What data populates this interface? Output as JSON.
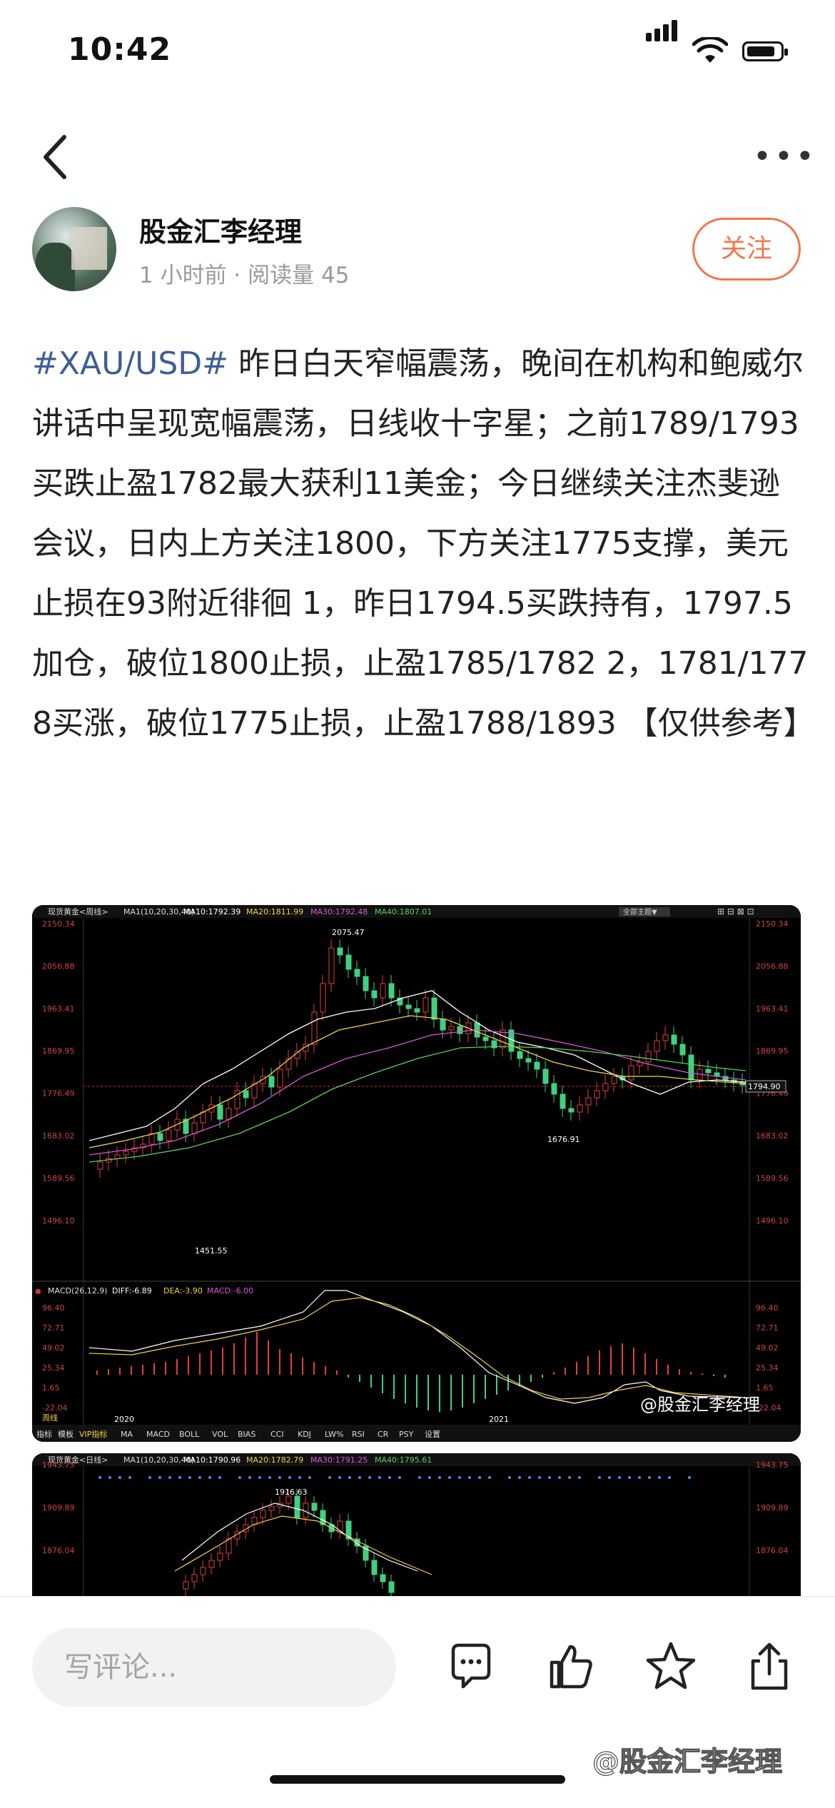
{
  "status": {
    "time": "10:42"
  },
  "author": {
    "name": "股金汇李经理",
    "meta": "1 小时前 · 阅读量 45",
    "follow_label": "关注"
  },
  "post": {
    "tag": "#XAU/USD#",
    "body": " 昨日白天窄幅震荡，晚间在机构和鲍威尔讲话中呈现宽幅震荡，日线收十字星；之前1789/1793买跌止盈1782最大获利11美金；今日继续关注杰斐逊会议，日内上方关注1800，下方关注1775支撑，美元止损在93附近徘徊 1，昨日1794.5买跌持有，1797.5加仓，破位1800止损，止盈1785/1782 2，1781/1778买涨，破位1775止损，止盈1788/1893 【仅供参考】"
  },
  "chart1": {
    "header_title": "现货黄金<周线>",
    "ma_label": "MA1(10,20,30,40)",
    "ma10": "MA10:1792.39",
    "ma20": "MA20:1811.99",
    "ma30": "MA30:1792.48",
    "ma40": "MA40:1807.01",
    "theme_button": "全部主题▼",
    "price_axis": [
      "2150.34",
      "2056.88",
      "1963.41",
      "1869.95",
      "1776.49",
      "1683.02",
      "1589.56",
      "1496.10"
    ],
    "current_price": "1794.90",
    "high_label": "2075.47",
    "low_label": "1451.55",
    "mid_low_label": "1676.91",
    "macd_header": "MACD(26,12,9)",
    "macd_diff": "DIFF:-6.89",
    "macd_dea": "DEA:-3.90",
    "macd_macd": "MACD:-6.00",
    "macd_axis": [
      "96.40",
      "72.71",
      "49.02",
      "25.34",
      "1.65",
      "-22.04"
    ],
    "period_label": "周线",
    "year_labels": [
      "2020",
      "2021"
    ],
    "indicator_tabs": [
      "指标",
      "模板",
      "VIP指标",
      "MA",
      "MACD",
      "BOLL",
      "VOL",
      "BIAS",
      "CCI",
      "KDJ",
      "LW%",
      "RSI",
      "CR",
      "PSY",
      "设置"
    ],
    "watermark": "@股金汇李经理"
  },
  "chart2": {
    "header_title": "现货黄金<日线>",
    "ma_label": "MA1(10,20,30,40)",
    "ma10": "MA10:1790.96",
    "ma20": "MA20:1782.79",
    "ma30": "MA30:1791.25",
    "ma40": "MA40:1795.61",
    "price_axis": [
      "1943.75",
      "1909.89",
      "1876.04"
    ],
    "high_label": "1916.63"
  },
  "bottom": {
    "comment_placeholder": "写评论...",
    "watermark": "@股金汇李经理"
  }
}
